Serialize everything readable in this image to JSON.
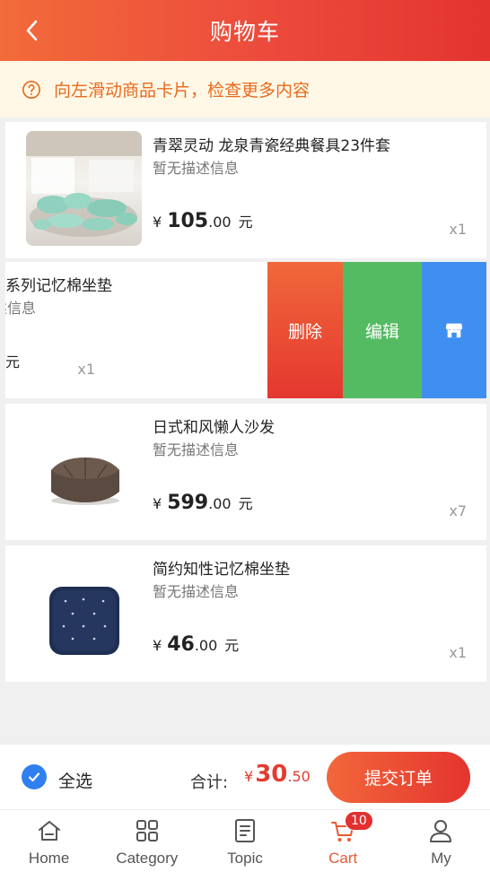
{
  "header": {
    "title": "购物车"
  },
  "notice": {
    "text": "向左滑动商品卡片，检查更多内容"
  },
  "items": [
    {
      "name": "青翠灵动 龙泉青瓷经典餐具23件套",
      "desc": "暂无描述信息",
      "currency": "¥",
      "price_int": "105",
      "price_dec": ".00",
      "unit": "元",
      "qty": "x1",
      "image": "ceramic-tableware-image"
    },
    {
      "name": "系列记忆棉坐垫",
      "desc": "暂无描述信息",
      "currency": "¥",
      "price_int": "",
      "price_dec": "",
      "unit": "元",
      "qty": "x1",
      "image": ""
    },
    {
      "name": "日式和风懒人沙发",
      "desc": "暂无描述信息",
      "currency": "¥",
      "price_int": "599",
      "price_dec": ".00",
      "unit": "元",
      "qty": "x7",
      "image": "bean-bag-sofa-image"
    },
    {
      "name": "简约知性记忆棉坐垫",
      "desc": "暂无描述信息",
      "currency": "¥",
      "price_int": "46",
      "price_dec": ".00",
      "unit": "元",
      "qty": "x1",
      "image": "seat-cushion-image"
    }
  ],
  "swipe_actions": {
    "delete": "删除",
    "edit": "编辑",
    "shop_icon": "shop-icon"
  },
  "checkout": {
    "select_all": "全选",
    "total_label": "合计:",
    "total_currency": "¥",
    "total_int": "30",
    "total_dec": ".50",
    "submit": "提交订单"
  },
  "tabs": [
    {
      "label": "Home",
      "icon": "home-icon"
    },
    {
      "label": "Category",
      "icon": "category-icon"
    },
    {
      "label": "Topic",
      "icon": "topic-icon"
    },
    {
      "label": "Cart",
      "icon": "cart-icon",
      "active": true
    },
    {
      "label": "My",
      "icon": "user-icon"
    }
  ],
  "cart_badge": "10",
  "colors": {
    "accent": "#e85a34",
    "delete": "#e4372f",
    "edit": "#55bb63",
    "shop": "#3f8ff0",
    "checkbox": "#2f7ff0"
  }
}
